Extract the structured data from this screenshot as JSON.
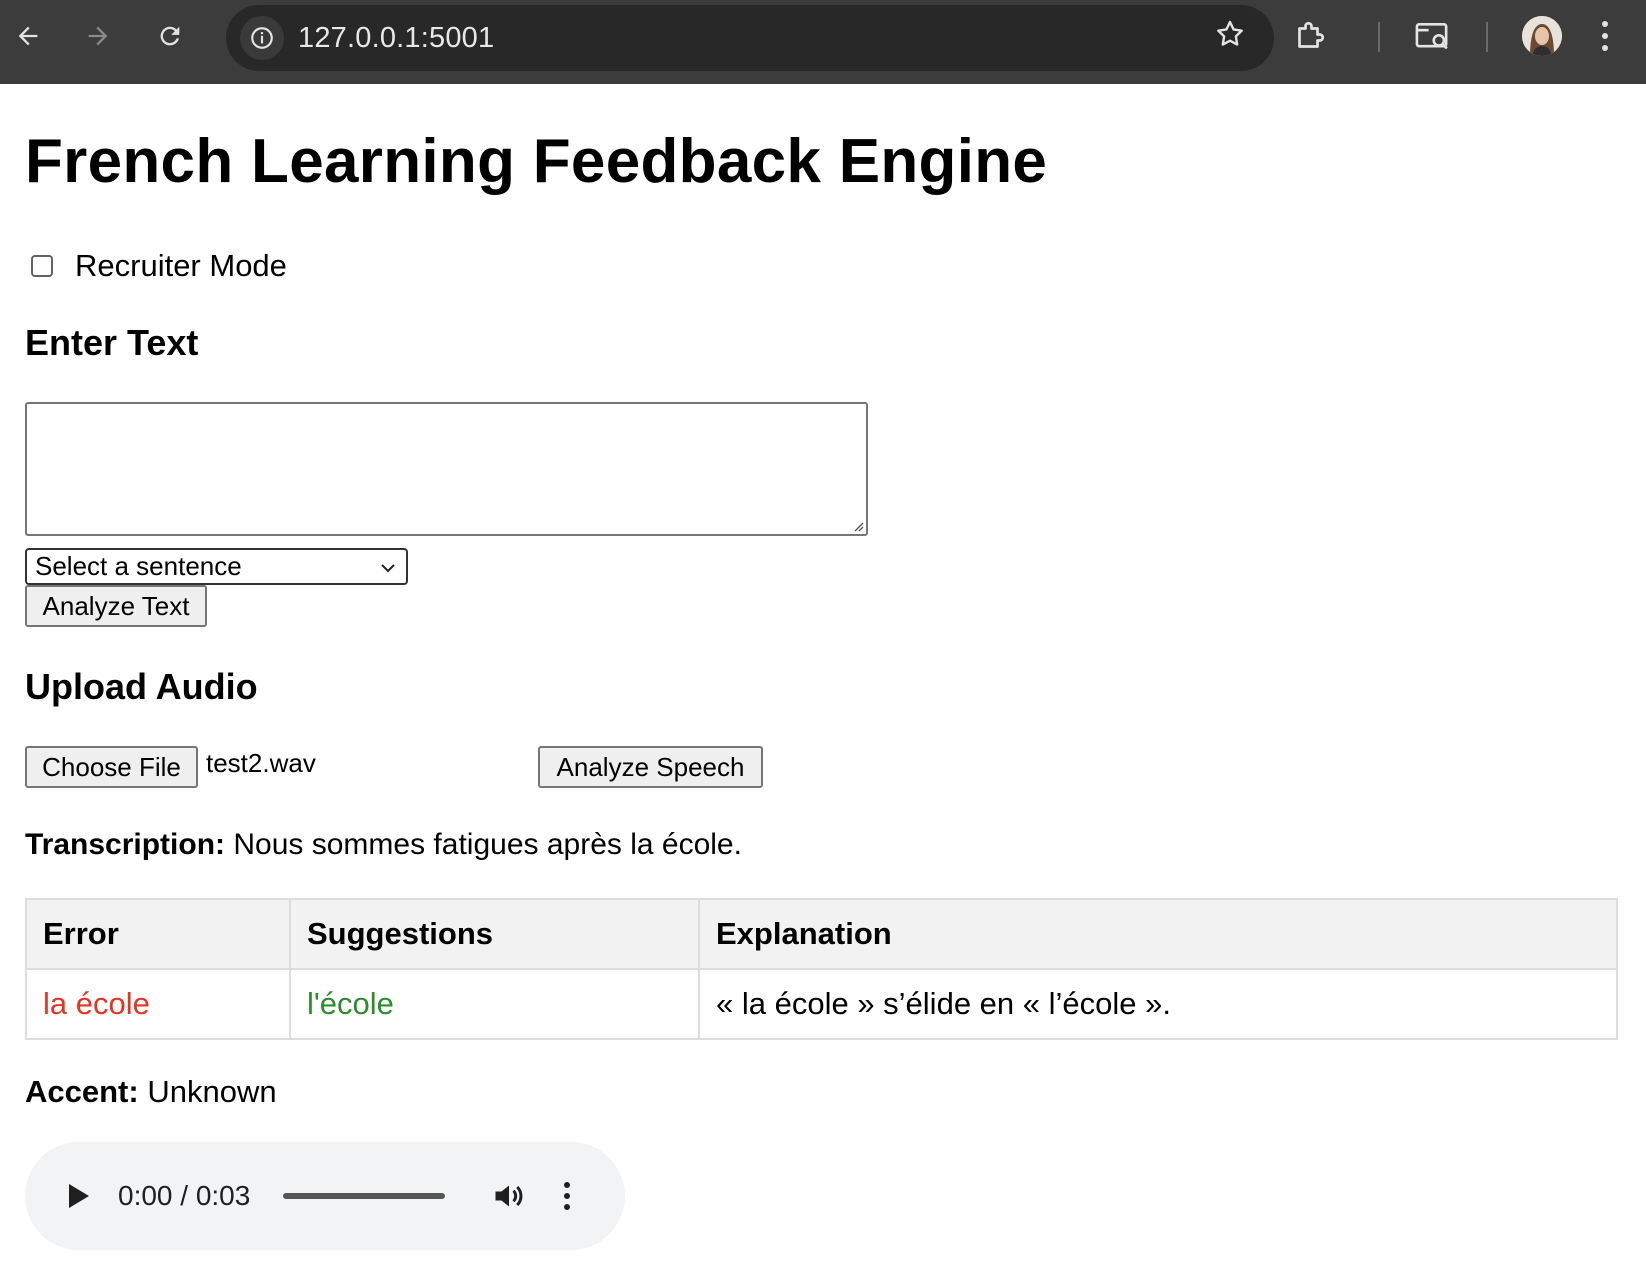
{
  "browser": {
    "url": "127.0.0.1:5001"
  },
  "page": {
    "title": "French Learning Feedback Engine",
    "recruiter_mode": {
      "label": "Recruiter Mode",
      "checked": false
    },
    "text_section": {
      "heading": "Enter Text",
      "textarea_value": "",
      "select_value": "Select a sentence",
      "analyze_button": "Analyze Text"
    },
    "audio_section": {
      "heading": "Upload Audio",
      "choose_file_button": "Choose File",
      "file_name": "test2.wav",
      "analyze_button": "Analyze Speech"
    },
    "transcription": {
      "label": "Transcription:",
      "value": "Nous sommes fatigues après la école."
    },
    "results_table": {
      "headers": [
        "Error",
        "Suggestions",
        "Explanation"
      ],
      "rows": [
        {
          "error": "la école",
          "suggestion": "l'école",
          "explanation": "« la école » s’élide en « l’école »."
        }
      ]
    },
    "accent": {
      "label": "Accent:",
      "value": "Unknown"
    },
    "audio_player": {
      "time": "0:00 / 0:03"
    }
  },
  "colors": {
    "error": "#e53424",
    "suggestion": "#2e8b2e",
    "chrome_bg": "#3c3c3c"
  }
}
